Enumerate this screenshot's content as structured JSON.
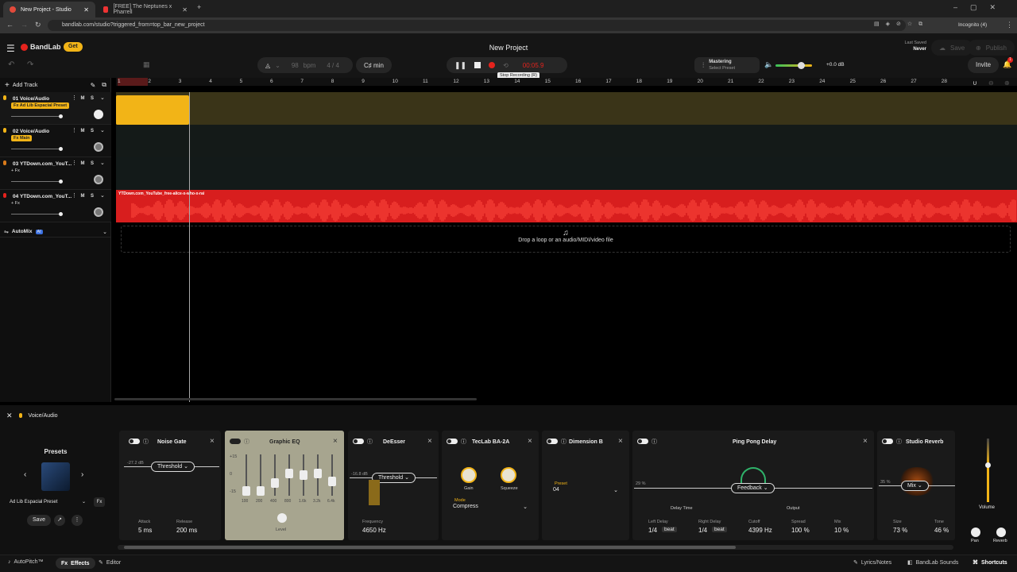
{
  "browser": {
    "tabs": [
      {
        "title": "New Project - Studio",
        "active": true
      },
      {
        "title": "[FREE] The Neptunes x Pharrell",
        "active": false
      }
    ],
    "url": "bandlab.com/studio?triggered_from=top_bar_new_project",
    "profile": "Incognito (4)"
  },
  "header": {
    "brand": "BandLab",
    "get_label": "Get",
    "project_title": "New Project",
    "last_saved_label": "Last Saved",
    "last_saved_value": "Never",
    "save_label": "Save",
    "publish_label": "Publish",
    "invite_label": "Invite",
    "notification_count": "1",
    "bpm_value": "98",
    "bpm_label": "bpm",
    "time_signature": "4 / 4",
    "key": "C♯ min",
    "time_display": "00:05.9",
    "tooltip": "Stop Recording (R)",
    "mastering_title": "Mastering",
    "mastering_sub": "Select Preset",
    "master_volume": "+0.0 dB"
  },
  "tracklist": {
    "add_track_label": "Add Track",
    "tracks": [
      {
        "number": "01",
        "name": "Voice/Audio",
        "fx": "Fx Ad Lib Espacial Preset",
        "fx_badge": true
      },
      {
        "number": "02",
        "name": "Voice/Audio",
        "fx": "Fx Main",
        "fx_badge": true
      },
      {
        "number": "03",
        "name": "YTDown.com_YouT...",
        "fx": "+ Fx",
        "fx_badge": false
      },
      {
        "number": "04",
        "name": "YTDown.com_YouT...",
        "fx": "+ Fx",
        "fx_badge": false
      }
    ],
    "automix_label": "AutoMix",
    "ai_badge": "AI",
    "mute_label": "M",
    "solo_label": "S"
  },
  "timeline": {
    "ruler": [
      "1",
      "2",
      "3",
      "4",
      "5",
      "6",
      "7",
      "8",
      "9",
      "10",
      "11",
      "12",
      "13",
      "14",
      "15",
      "16",
      "17",
      "18",
      "19",
      "20",
      "21",
      "22",
      "23",
      "24",
      "25",
      "26",
      "27",
      "28"
    ],
    "clip_name": "YTDown.com_YouTube_free-alice-x-who-x-rai",
    "drop_text": "Drop a loop or an audio/MIDI/video file"
  },
  "fxpanel": {
    "track_label": "Voice/Audio",
    "presets_title": "Presets",
    "preset_name": "Ad Lib Espacial Preset",
    "save_label": "Save",
    "noise_gate": {
      "title": "Noise Gate",
      "threshold_value": "-27.2 dB",
      "control": "Threshold",
      "attack_label": "Attack",
      "attack_value": "5 ms",
      "release_label": "Release",
      "release_value": "200 ms"
    },
    "graphic_eq": {
      "title": "Graphic EQ",
      "scale": [
        "+15",
        "0",
        "-15"
      ],
      "bands": [
        "100",
        "200",
        "400",
        "800",
        "1.6k",
        "3.2k",
        "6.4k"
      ],
      "level_label": "Level"
    },
    "deesser": {
      "title": "DeEsser",
      "threshold_value": "-16.8 dB",
      "control": "Threshold",
      "freq_label": "Frequency",
      "freq_value": "4650 Hz"
    },
    "teclab": {
      "title": "TecLab BA-2A",
      "gain_label": "Gain",
      "squeeze_label": "Squeeze",
      "mode_label": "Mode",
      "mode_value": "Compress"
    },
    "dimension": {
      "title": "Dimension B",
      "preset_label": "Preset",
      "preset_value": "04"
    },
    "pingpong": {
      "title": "Ping Pong Delay",
      "amount": "29 %",
      "control": "Feedback",
      "delay_time_label": "Delay Time",
      "output_label": "Output",
      "left_label": "Left Delay",
      "left_value": "1/4",
      "left_unit": "beat",
      "right_label": "Right Delay",
      "right_value": "1/4",
      "right_unit": "beat",
      "cutoff_label": "Cutoff",
      "cutoff_value": "4399 Hz",
      "spread_label": "Spread",
      "spread_value": "100 %",
      "mix_label": "Mix",
      "mix_value": "10 %"
    },
    "reverb": {
      "title": "Studio Reverb",
      "amount": "35 %",
      "control": "Mix",
      "size_label": "Size",
      "size_value": "73 %",
      "tone_label": "Tone",
      "tone_value": "46 %"
    },
    "volume_label": "Volume",
    "pan_label": "Pan",
    "reverb_label": "Reverb"
  },
  "bottombar": {
    "autopitch": "AutoPitch™",
    "effects": "Effects",
    "editor": "Editor",
    "lyrics": "Lyrics/Notes",
    "sounds": "BandLab Sounds",
    "shortcuts": "Shortcuts"
  },
  "colors": {
    "accent": "#f2b417",
    "record": "#e5231d",
    "clip": "#d81e1e",
    "lane_yellow": "#3a3418"
  }
}
